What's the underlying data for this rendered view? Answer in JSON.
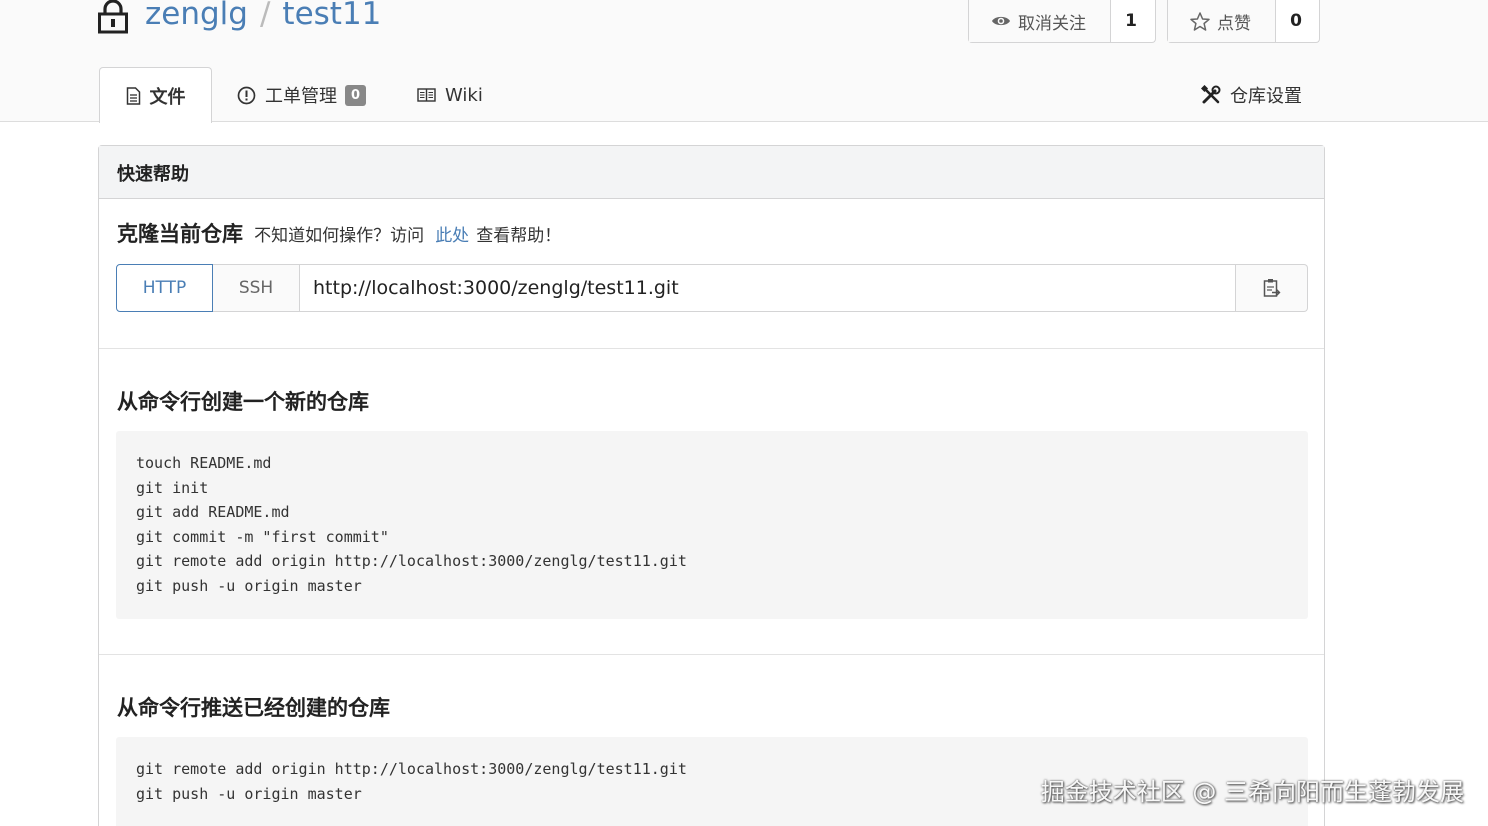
{
  "repo": {
    "owner": "zenglg",
    "separator": "/",
    "name": "test11"
  },
  "watch": {
    "label": "取消关注",
    "count": "1"
  },
  "star": {
    "label": "点赞",
    "count": "0"
  },
  "tabs": {
    "files": "文件",
    "issues": "工单管理",
    "issues_count": "0",
    "wiki": "Wiki",
    "settings": "仓库设置"
  },
  "quick_help": {
    "header": "快速帮助",
    "clone_title": "克隆当前仓库",
    "clone_hint_pre": "不知道如何操作？访问",
    "clone_hint_link": "此处",
    "clone_hint_post": "查看帮助！",
    "http_label": "HTTP",
    "ssh_label": "SSH",
    "clone_url": "http://localhost:3000/zenglg/test11.git"
  },
  "new_repo": {
    "title": "从命令行创建一个新的仓库",
    "code": "touch README.md\ngit init\ngit add README.md\ngit commit -m \"first commit\"\ngit remote add origin http://localhost:3000/zenglg/test11.git\ngit push -u origin master"
  },
  "push_existing": {
    "title": "从命令行推送已经创建的仓库",
    "code": "git remote add origin http://localhost:3000/zenglg/test11.git\ngit push -u origin master"
  },
  "watermark": "掘金技术社区 @ 三希向阳而生蓬勃发展",
  "colors": {
    "link": "#4a7eb5",
    "panel_header": "#f3f4f5",
    "code_bg": "#f5f5f5"
  }
}
